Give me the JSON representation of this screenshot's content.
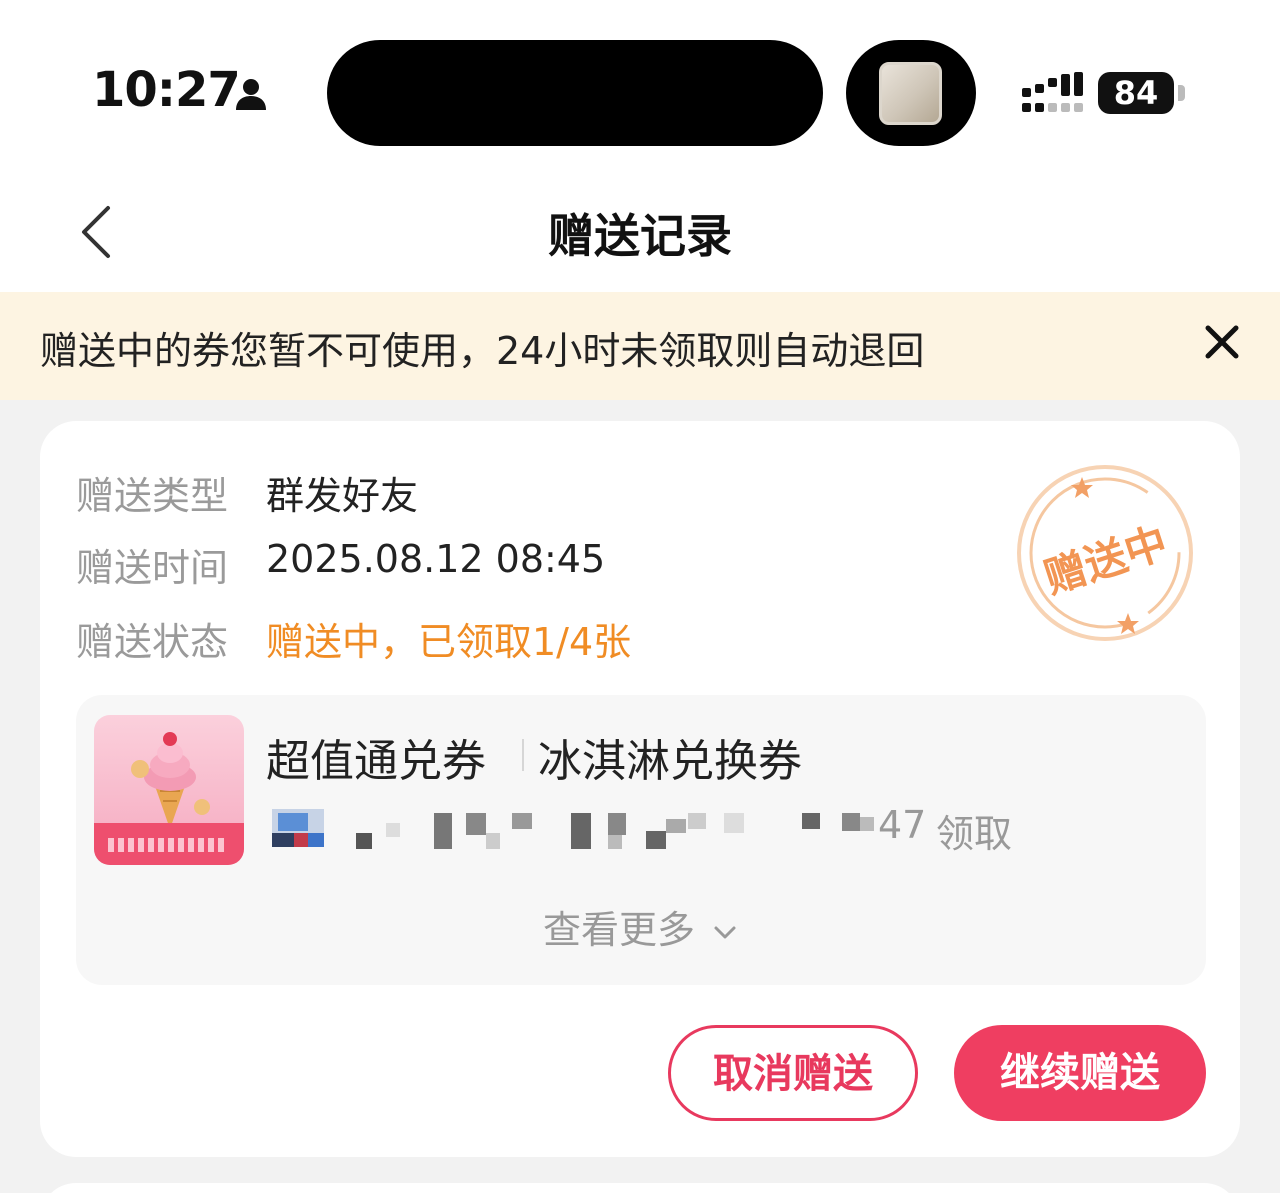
{
  "status_bar": {
    "time": "10:27",
    "battery": "84"
  },
  "header": {
    "title": "赠送记录"
  },
  "notice": {
    "text": "赠送中的券您暂不可使用，24小时未领取则自动退回"
  },
  "record": {
    "labels": {
      "type": "赠送类型",
      "time": "赠送时间",
      "status": "赠送状态"
    },
    "type": "群发好友",
    "time": "2025.08.12 08:45",
    "status": "赠送中，已领取1/4张",
    "stamp": "赠送中",
    "coupon": {
      "category": "超值通兑券",
      "name": "冰淇淋兑换券",
      "claim_count": "47",
      "claim_text": "领取"
    },
    "view_more": "查看更多",
    "buttons": {
      "cancel": "取消赠送",
      "continue": "继续赠送"
    }
  },
  "colors": {
    "accent_pink": "#ef3e61",
    "status_orange": "#f08c24",
    "notice_bg": "#fdf4e2"
  },
  "icons": [
    "person-icon",
    "signal-icon",
    "back-icon",
    "close-icon",
    "stamp-icon",
    "ice-cream-icon",
    "chevron-down-icon"
  ]
}
